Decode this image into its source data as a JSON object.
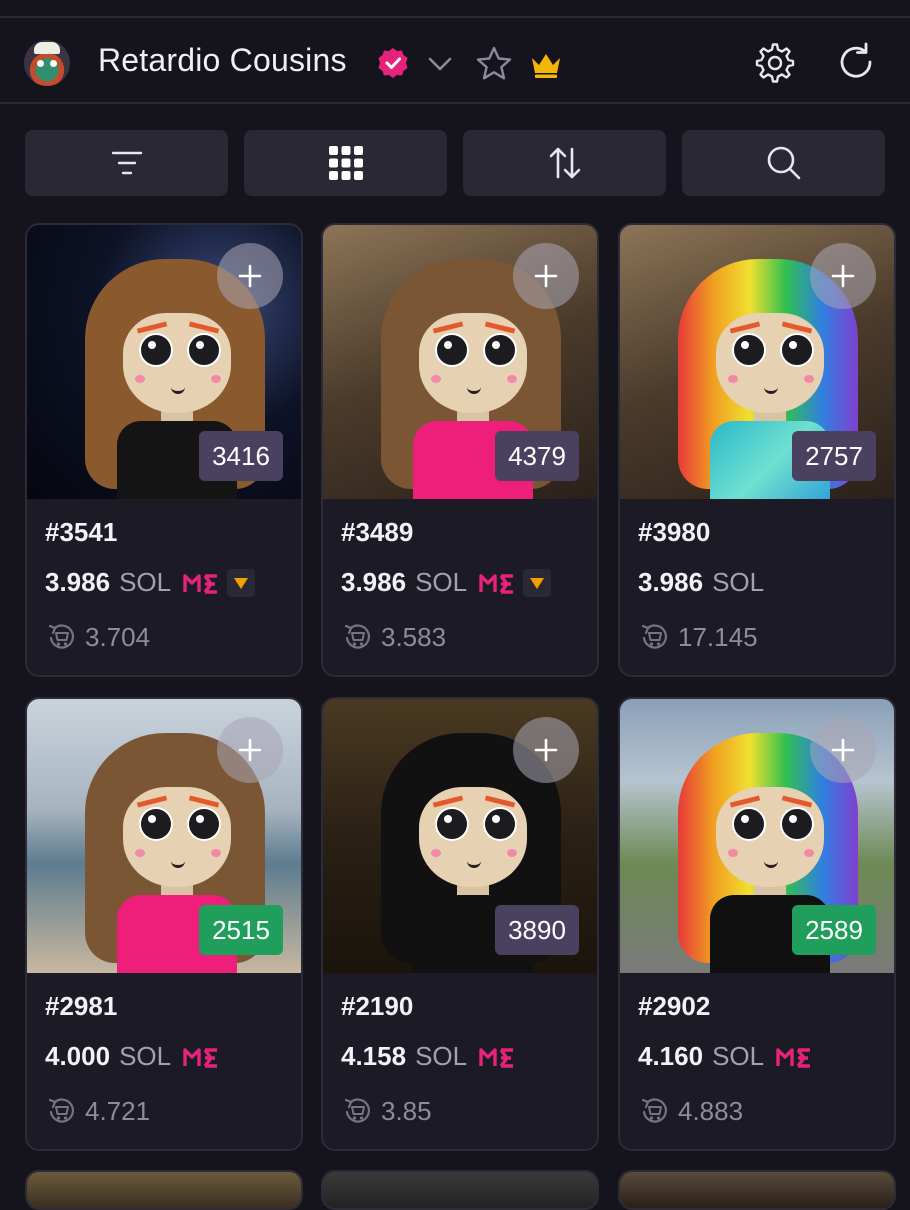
{
  "header": {
    "title": "Retardio Cousins",
    "icons": [
      "avatar",
      "verified-icon",
      "chevron-down-icon",
      "star-icon",
      "crown-icon",
      "gear-icon",
      "refresh-icon"
    ]
  },
  "toolbar": {
    "buttons": [
      "filter-icon",
      "grid-icon",
      "sort-icon",
      "search-icon"
    ]
  },
  "colors": {
    "accent_pink": "#e5237b",
    "badge_purple": "#4a4160",
    "badge_green": "#1f9e5c",
    "crown": "#f2b705",
    "down_arrow": "#f2a100"
  },
  "cards": [
    {
      "id": "#3541",
      "price": "3.986",
      "currency": "SOL",
      "last": "3.704",
      "rank": "3416",
      "rank_color": "purple",
      "me": true,
      "down": true
    },
    {
      "id": "#3489",
      "price": "3.986",
      "currency": "SOL",
      "last": "3.583",
      "rank": "4379",
      "rank_color": "purple",
      "me": true,
      "down": true
    },
    {
      "id": "#3980",
      "price": "3.986",
      "currency": "SOL",
      "last": "17.145",
      "rank": "2757",
      "rank_color": "purple",
      "me": false,
      "down": false
    },
    {
      "id": "#2981",
      "price": "4.000",
      "currency": "SOL",
      "last": "4.721",
      "rank": "2515",
      "rank_color": "green",
      "me": true,
      "down": false
    },
    {
      "id": "#2190",
      "price": "4.158",
      "currency": "SOL",
      "last": "3.85",
      "rank": "3890",
      "rank_color": "purple",
      "me": true,
      "down": false
    },
    {
      "id": "#2902",
      "price": "4.160",
      "currency": "SOL",
      "last": "4.883",
      "rank": "2589",
      "rank_color": "green",
      "me": true,
      "down": false
    }
  ]
}
